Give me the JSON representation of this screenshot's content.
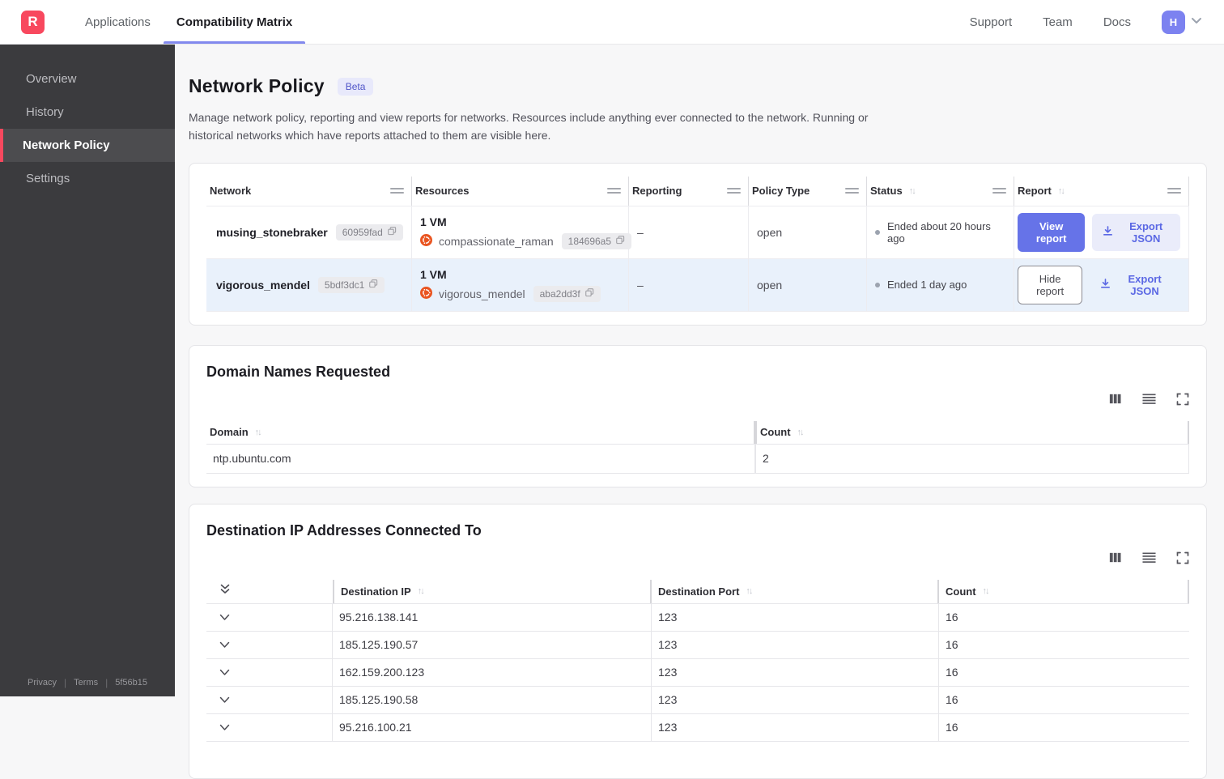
{
  "navbar": {
    "logo_letter": "R",
    "tabs": [
      {
        "label": "Applications",
        "active": false
      },
      {
        "label": "Compatibility Matrix",
        "active": true
      }
    ],
    "right_links": [
      "Support",
      "Team",
      "Docs"
    ],
    "avatar_letter": "H"
  },
  "sidebar": {
    "items": [
      {
        "label": "Overview",
        "active": false
      },
      {
        "label": "History",
        "active": false
      },
      {
        "label": "Network Policy",
        "active": true
      },
      {
        "label": "Settings",
        "active": false
      }
    ],
    "footer": {
      "privacy": "Privacy",
      "terms": "Terms",
      "version": "5f56b15"
    }
  },
  "page": {
    "title": "Network Policy",
    "badge": "Beta",
    "description": "Manage network policy, reporting and view reports for networks. Resources include anything ever connected to the network. Running or historical networks which have reports attached to them are visible here."
  },
  "network_table": {
    "columns": [
      "Network",
      "Resources",
      "Reporting",
      "Policy Type",
      "Status",
      "Report"
    ],
    "rows": [
      {
        "network": "musing_stonebraker",
        "network_hash": "60959fad",
        "resources_count": "1 VM",
        "resource_name": "compassionate_raman",
        "resource_hash": "184696a5",
        "reporting": "–",
        "policy_type": "open",
        "status": "Ended about 20 hours ago",
        "report_button": "View report",
        "export_label": "Export JSON"
      },
      {
        "network": "vigorous_mendel",
        "network_hash": "5bdf3dc1",
        "resources_count": "1 VM",
        "resource_name": "vigorous_mendel",
        "resource_hash": "aba2dd3f",
        "reporting": "–",
        "policy_type": "open",
        "status": "Ended 1 day ago",
        "report_button": "Hide report",
        "export_label": "Export JSON"
      }
    ]
  },
  "domain_card": {
    "title": "Domain Names Requested",
    "columns": [
      "Domain",
      "Count"
    ],
    "rows": [
      {
        "domain": "ntp.ubuntu.com",
        "count": "2"
      }
    ]
  },
  "destination_card": {
    "title": "Destination IP Addresses Connected To",
    "columns": [
      "Destination IP",
      "Destination Port",
      "Count"
    ],
    "rows": [
      {
        "ip": "95.216.138.141",
        "port": "123",
        "count": "16"
      },
      {
        "ip": "185.125.190.57",
        "port": "123",
        "count": "16"
      },
      {
        "ip": "162.159.200.123",
        "port": "123",
        "count": "16"
      },
      {
        "ip": "185.125.190.58",
        "port": "123",
        "count": "16"
      },
      {
        "ip": "95.216.100.21",
        "port": "123",
        "count": "16"
      }
    ]
  },
  "icons": {
    "toolbar": [
      "columns-icon",
      "rows-icon",
      "fullscreen-icon"
    ],
    "row_badge": "copy-icon",
    "resource": "ubuntu-icon",
    "export": "download-icon",
    "expander": "chevron-down-icon",
    "expand_all": "double-chevron-down-icon"
  },
  "colors": {
    "accent": "#6673e8",
    "accent_light": "#eaecfa",
    "brand_red": "#f8485e",
    "selected_row": "#e9f1fb",
    "sidebar_bg": "#3b3b3e",
    "sidebar_active_bg": "#4c4c4f",
    "ubuntu_orange": "#e95420"
  }
}
